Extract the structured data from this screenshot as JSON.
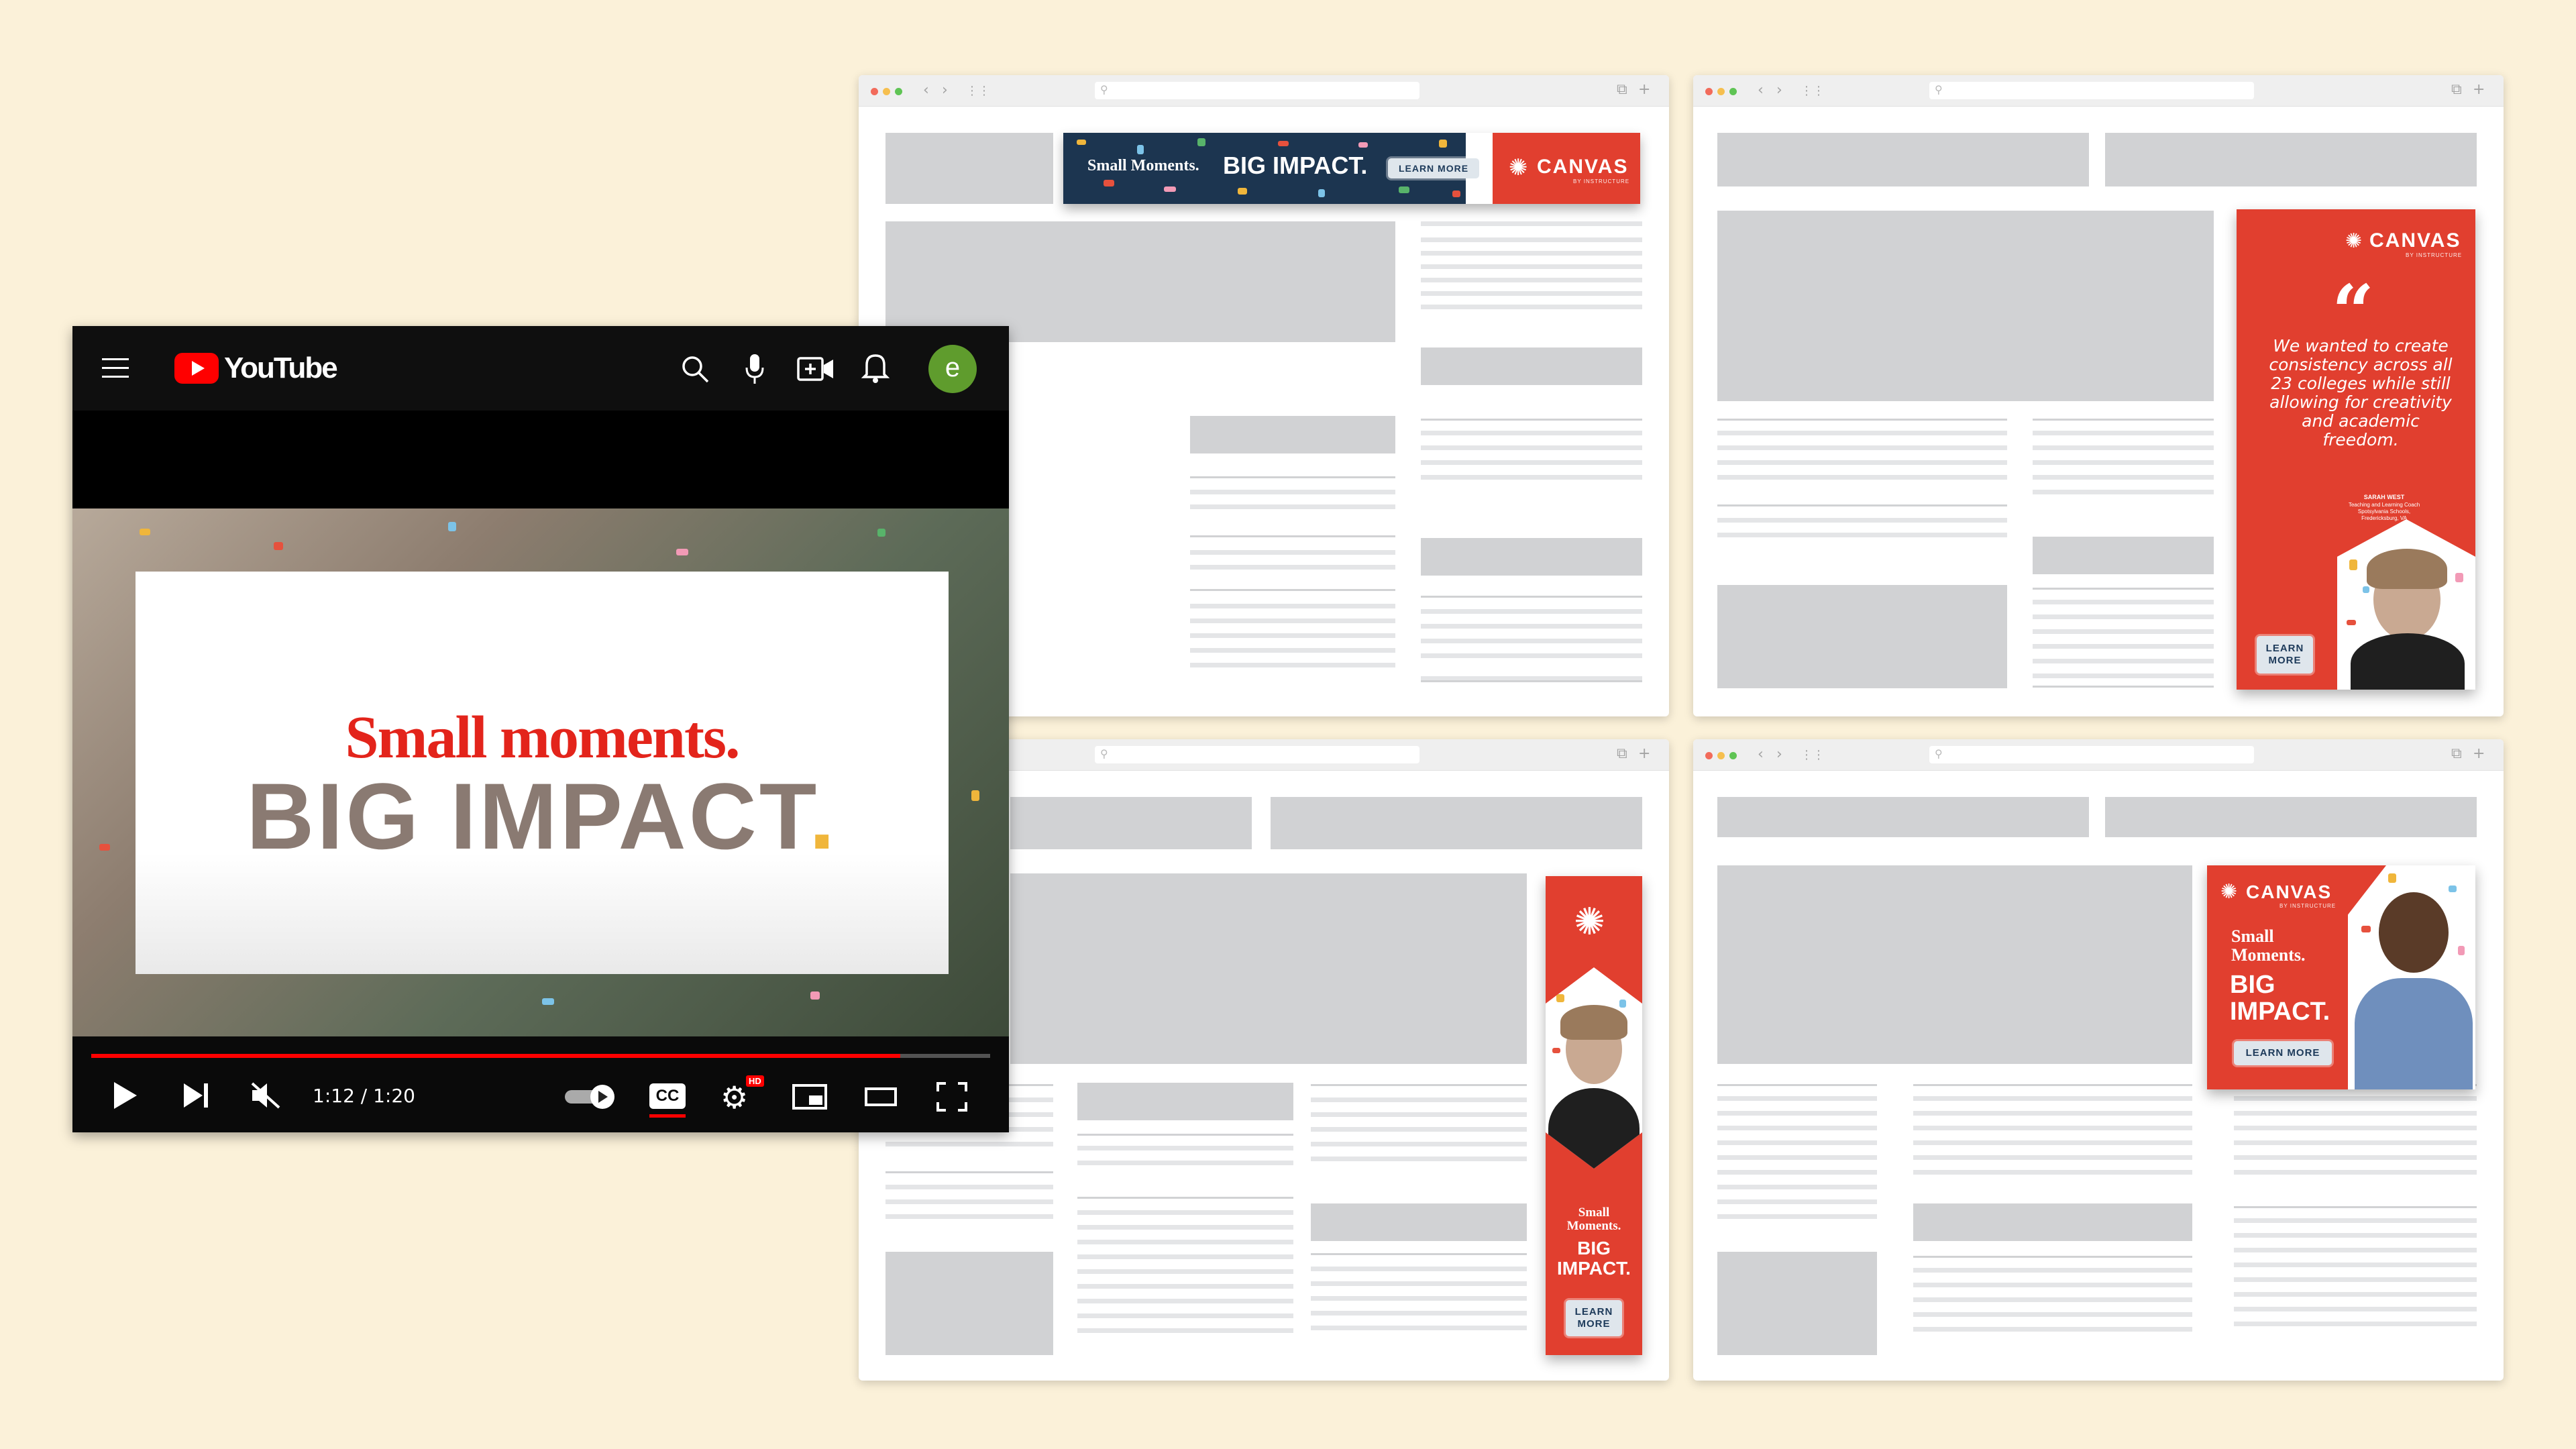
{
  "youtube": {
    "brand": "YouTube",
    "avatar_letter": "e",
    "headline_line1": "Small moments.",
    "headline_line2": "BIG IMPACT",
    "headline_dot": ".",
    "time": "1:12 / 1:20",
    "progress": 0.9,
    "cc_label": "CC",
    "hd_badge": "HD",
    "icons": [
      "hamburger-icon",
      "youtube-logo-icon",
      "search-icon",
      "microphone-icon",
      "create-video-icon",
      "notification-bell-icon",
      "play-icon",
      "next-icon",
      "muted-speaker-icon",
      "autoplay-toggle-icon",
      "captions-icon",
      "settings-gear-icon",
      "miniplayer-icon",
      "theater-mode-icon",
      "fullscreen-icon"
    ]
  },
  "ads": {
    "leaderboard": {
      "text_small": "Small Moments.",
      "text_big": "BIG IMPACT.",
      "button": "LEARN MORE",
      "logo": "CANVAS",
      "logo_sub": "BY INSTRUCTURE"
    },
    "quote": {
      "logo": "CANVAS",
      "logo_sub": "BY INSTRUCTURE",
      "quote_mark": "“",
      "quote_text": "We wanted to create consistency across all 23 colleges while still allowing for creativity and academic freedom.",
      "attribution_name": "SARAH WEST",
      "attribution_line1": "Teaching and Learning Coach",
      "attribution_line2": "Spotsylvania Schools,",
      "attribution_line3": "Fredericksburg, VA",
      "button_line1": "LEARN",
      "button_line2": "MORE"
    },
    "skyscraper": {
      "small_line1": "Small",
      "small_line2": "Moments.",
      "big_line1": "BIG",
      "big_line2": "IMPACT.",
      "button_line1": "LEARN",
      "button_line2": "MORE"
    },
    "rectangle": {
      "logo": "CANVAS",
      "logo_sub": "BY INSTRUCTURE",
      "small_line1": "Small",
      "small_line2": "Moments.",
      "big_line1": "BIG",
      "big_line2": "IMPACT.",
      "button": "LEARN MORE"
    }
  },
  "colors": {
    "background": "#fbf1d9",
    "canvas_red": "#e13f2f",
    "youtube_red": "#ff0000",
    "placeholder_gray": "#d1d2d4",
    "avatar_green": "#5f9c2d"
  }
}
